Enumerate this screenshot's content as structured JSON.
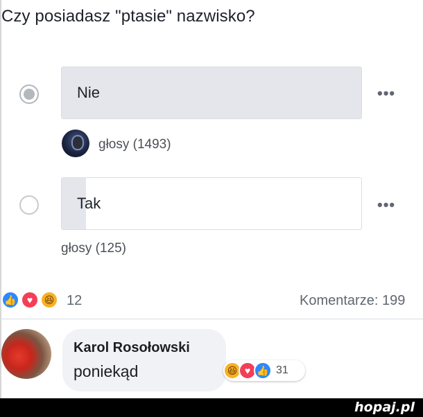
{
  "poll": {
    "question": "Czy posiadasz \"ptasie\" nazwisko?",
    "options": [
      {
        "label": "Nie",
        "selected": true,
        "votes_text": "głosy (1493)",
        "fill_fraction": 1.0
      },
      {
        "label": "Tak",
        "selected": false,
        "votes_text": "głosy (125)",
        "fill_fraction": 0.08
      }
    ],
    "more_label": "•••"
  },
  "reactions": {
    "icons": [
      "like-icon",
      "love-icon",
      "haha-icon"
    ],
    "count": "12",
    "comments_label": "Komentarze: 199"
  },
  "comment": {
    "author": "Karol Rosołowski",
    "text": "poniekąd",
    "reaction_icons": [
      "haha-icon",
      "love-icon",
      "like-icon"
    ],
    "reaction_count": "31"
  },
  "watermark": "hopaj.pl",
  "colors": {
    "like": "#2d88ff",
    "love": "#f33e58",
    "haha": "#f7b125",
    "bar_fill": "#e4e6eb",
    "bubble": "#f0f2f5"
  }
}
